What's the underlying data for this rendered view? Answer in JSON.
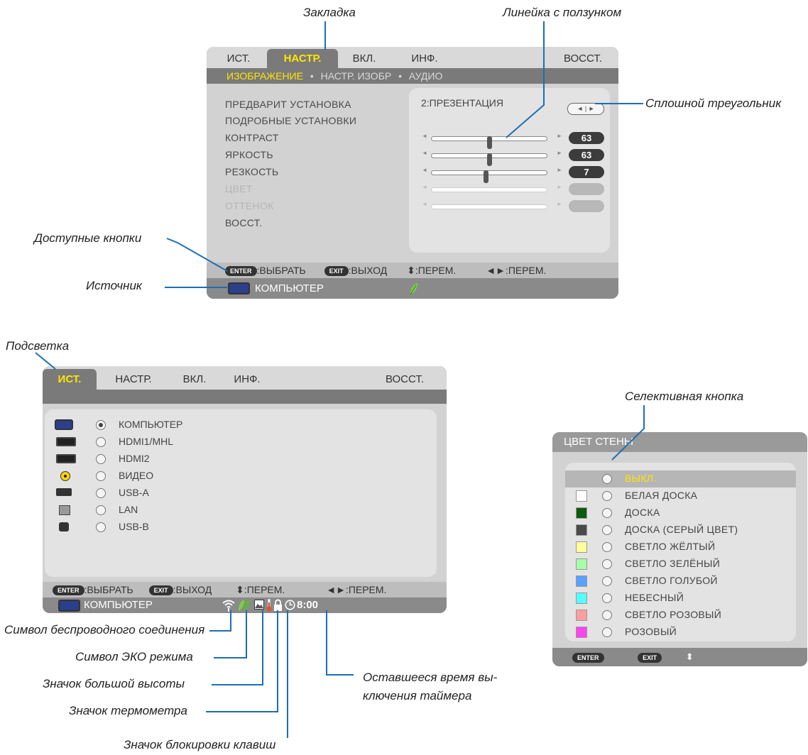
{
  "annotations": {
    "tab": "Закладка",
    "slider_bar": "Линейка с ползунком",
    "solid_triangle": "Сплошной треугольник",
    "available_buttons": "Доступные кнопки",
    "source": "Источник",
    "highlight": "Подсветка",
    "radio_button": "Селективная кнопка",
    "wireless_symbol": "Символ беспроводного соединения",
    "eco_symbol": "Символ ЭКО режима",
    "altitude_icon": "Значок большой высоты",
    "thermometer_icon": "Значок термометра",
    "key_lock_icon": "Значок блокировки клавиш",
    "timer_remaining_line1": "Оставшееся время вы-",
    "timer_remaining_line2": "ключения таймера"
  },
  "tabs": [
    "ИСТ.",
    "НАСТР.",
    "ВКЛ.",
    "ИНФ.",
    "ВОССТ."
  ],
  "menu1": {
    "active_tab": "НАСТР.",
    "subtabs": [
      "ИЗОБРАЖЕНИЕ",
      "•",
      "НАСТР. ИЗОБР",
      "•",
      "АУДИО"
    ],
    "items": [
      "ПРЕДВАРИТ УСТАНОВКА",
      "ПОДРОБНЫЕ УСТАНОВКИ",
      "КОНТРАСТ",
      "ЯРКОСТЬ",
      "РЕЗКОСТЬ",
      "ЦВЕТ",
      "ОТТЕНОК",
      "ВОССТ."
    ],
    "preset_value": "2:ПРЕЗЕНТАЦИЯ",
    "arrows": "◄ | ►",
    "sliders": [
      {
        "name": "contrast",
        "value": "63",
        "level": 0.5
      },
      {
        "name": "brightness",
        "value": "63",
        "level": 0.5
      },
      {
        "name": "sharpness",
        "value": "7",
        "level": 0.47
      },
      {
        "name": "color",
        "value": "",
        "level": null
      },
      {
        "name": "hue",
        "value": "",
        "level": null
      }
    ]
  },
  "footer": {
    "enter_key": "ENTER",
    "enter_text": ":ВЫБРАТЬ",
    "exit_key": "EXIT",
    "exit_text": ":ВЫХОД",
    "updown": "⬍:ПЕРЕМ.",
    "leftright": "◄►:ПЕРЕМ."
  },
  "source_name": "КОМПЬЮТЕР",
  "menu2": {
    "active_tab": "ИСТ.",
    "inputs": [
      {
        "label": "КОМПЬЮТЕР",
        "icon": "vga-icon",
        "selected": true
      },
      {
        "label": "HDMI1/MHL",
        "icon": "hdmi-icon",
        "selected": false
      },
      {
        "label": "HDMI2",
        "icon": "hdmi-icon",
        "selected": false
      },
      {
        "label": "ВИДЕО",
        "icon": "rca-icon",
        "selected": false
      },
      {
        "label": "USB-A",
        "icon": "usb-a-icon",
        "selected": false
      },
      {
        "label": "LAN",
        "icon": "lan-icon",
        "selected": false
      },
      {
        "label": "USB-B",
        "icon": "usb-b-icon",
        "selected": false
      }
    ],
    "timer": "8:00"
  },
  "menu3": {
    "title": "ЦВЕТ СТЕНЫ",
    "options": [
      {
        "label": "ВЫКЛ.",
        "swatch": null,
        "selected": true
      },
      {
        "label": "БЕЛАЯ ДОСКА",
        "swatch": "#ffffff"
      },
      {
        "label": "ДОСКА",
        "swatch": "#0c5a0c"
      },
      {
        "label": "ДОСКА (СЕРЫЙ ЦВЕТ)",
        "swatch": "#4a4a4a"
      },
      {
        "label": "СВЕТЛО ЖЁЛТЫЙ",
        "swatch": "#ffff99"
      },
      {
        "label": "СВЕТЛО ЗЕЛЁНЫЙ",
        "swatch": "#a6ffa6"
      },
      {
        "label": "СВЕТЛО ГОЛУБОЙ",
        "swatch": "#5aa0ff"
      },
      {
        "label": "НЕБЕСНЫЙ",
        "swatch": "#55ffff"
      },
      {
        "label": "СВЕТЛО РОЗОВЫЙ",
        "swatch": "#ff9e9e"
      },
      {
        "label": "РОЗОВЫЙ",
        "swatch": "#ff44ee"
      }
    ],
    "enter_key": "ENTER",
    "exit_key": "EXIT",
    "updown": "⬍"
  },
  "colors": {
    "highlight": "#ffe500",
    "leader": "#1a6fb5"
  }
}
